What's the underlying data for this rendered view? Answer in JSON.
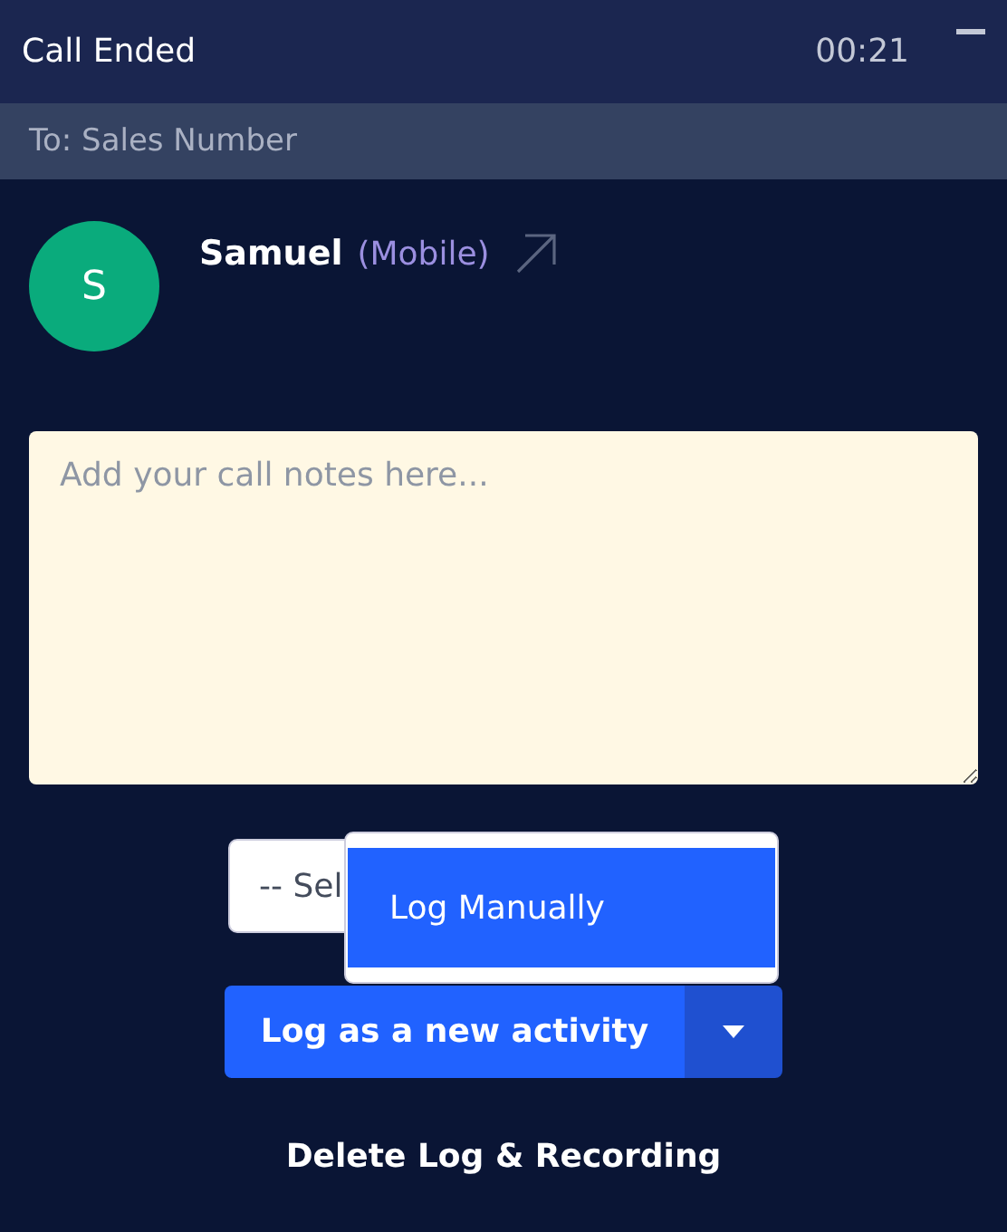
{
  "header": {
    "title": "Call Ended",
    "timer": "00:21"
  },
  "recipient": "To: Sales Number",
  "contact": {
    "initial": "S",
    "name": "Samuel",
    "phone_type": "(Mobile)"
  },
  "notes": {
    "placeholder": "Add your call notes here..."
  },
  "select": {
    "value": "-- Sel"
  },
  "menu": {
    "items": [
      {
        "label": "Log Manually",
        "selected": true
      }
    ]
  },
  "log_button": "Log as a new activity",
  "delete_button": "Delete Log & Recording"
}
